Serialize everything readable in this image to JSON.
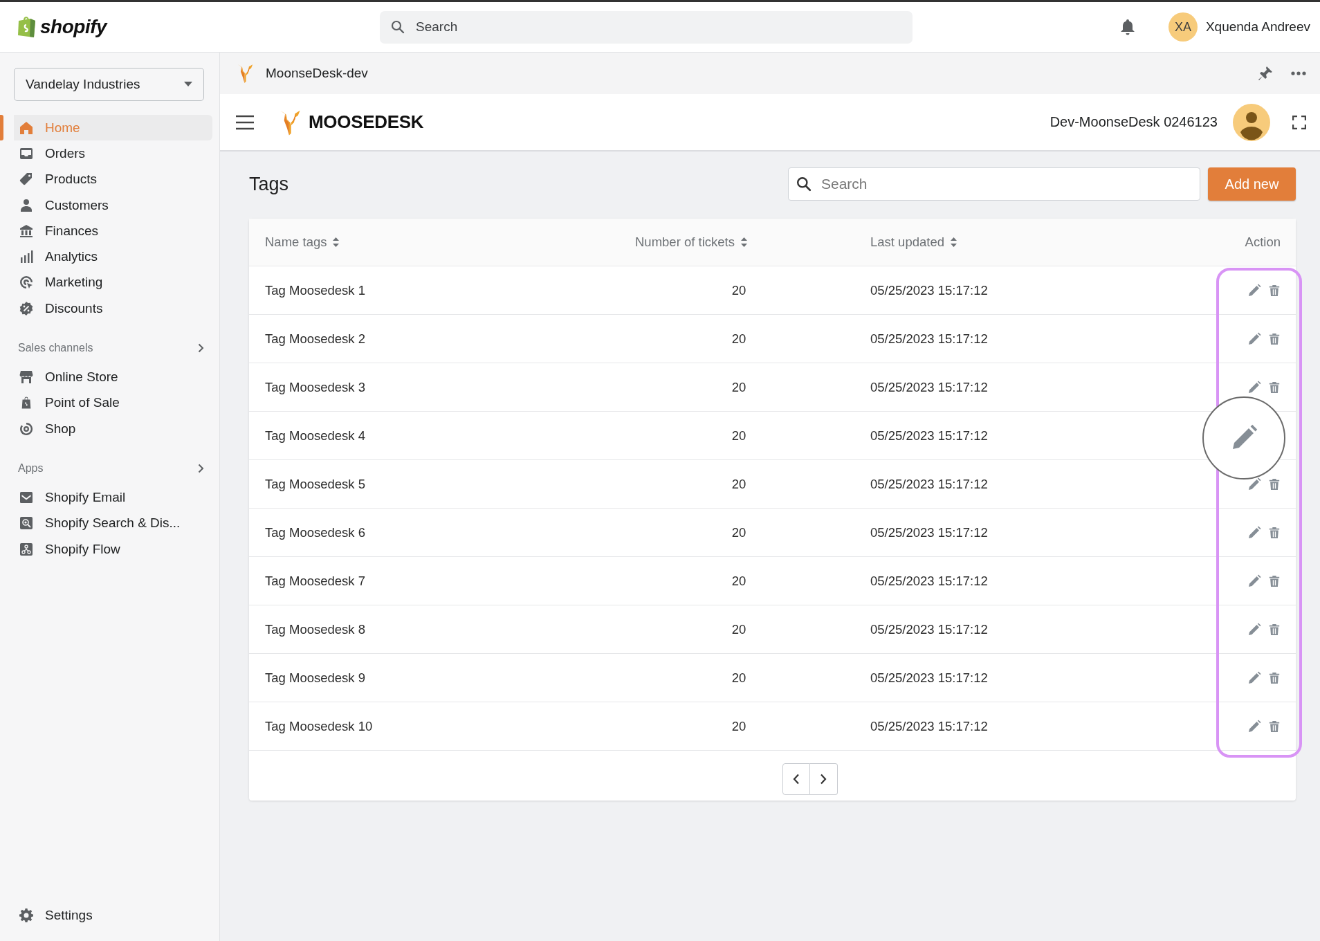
{
  "topbar": {
    "logo_text": "shopify",
    "search": {
      "placeholder": "Search"
    },
    "user": {
      "initials": "XA",
      "name": "Xquenda Andreev"
    }
  },
  "sidebar": {
    "store": "Vandelay Industries",
    "items": [
      {
        "label": "Home",
        "selected": true
      },
      {
        "label": "Orders",
        "selected": false
      },
      {
        "label": "Products",
        "selected": false
      },
      {
        "label": "Customers",
        "selected": false
      },
      {
        "label": "Finances",
        "selected": false
      },
      {
        "label": "Analytics",
        "selected": false
      },
      {
        "label": "Marketing",
        "selected": false
      },
      {
        "label": "Discounts",
        "selected": false
      }
    ],
    "sections": [
      {
        "title": "Sales channels",
        "items": [
          {
            "label": "Online Store",
            "selected": false
          },
          {
            "label": "Point of Sale",
            "selected": false
          },
          {
            "label": "Shop",
            "selected": false
          }
        ]
      },
      {
        "title": "Apps",
        "items": [
          {
            "label": "Shopify Email",
            "selected": false
          },
          {
            "label": "Shopify Search & Dis...",
            "selected": false
          },
          {
            "label": "Shopify Flow",
            "selected": false
          }
        ]
      }
    ],
    "settings": "Settings"
  },
  "app_bar": {
    "title": "MoonseDesk-dev"
  },
  "app_header": {
    "logo_text": "MOOSEDESK",
    "account": "Dev-MoonseDesk 0246123"
  },
  "page": {
    "title": "Tags",
    "search": {
      "placeholder": "Search"
    },
    "add_button": "Add new"
  },
  "table": {
    "columns": [
      {
        "label": "Name tags",
        "sortable": true
      },
      {
        "label": "Number of tickets",
        "sortable": true
      },
      {
        "label": "Last updated",
        "sortable": true
      },
      {
        "label": "Action",
        "sortable": false
      }
    ],
    "rows": [
      {
        "name": "Tag Moosedesk 1",
        "tickets": "20",
        "updated": "05/25/2023 15:17:12",
        "magnified": false
      },
      {
        "name": "Tag Moosedesk 2",
        "tickets": "20",
        "updated": "05/25/2023 15:17:12",
        "magnified": false
      },
      {
        "name": "Tag Moosedesk 3",
        "tickets": "20",
        "updated": "05/25/2023 15:17:12",
        "magnified": false
      },
      {
        "name": "Tag Moosedesk 4",
        "tickets": "20",
        "updated": "05/25/2023 15:17:12",
        "magnified": true
      },
      {
        "name": "Tag Moosedesk 5",
        "tickets": "20",
        "updated": "05/25/2023 15:17:12",
        "magnified": false
      },
      {
        "name": "Tag Moosedesk 6",
        "tickets": "20",
        "updated": "05/25/2023 15:17:12",
        "magnified": false
      },
      {
        "name": "Tag Moosedesk 7",
        "tickets": "20",
        "updated": "05/25/2023 15:17:12",
        "magnified": false
      },
      {
        "name": "Tag Moosedesk 8",
        "tickets": "20",
        "updated": "05/25/2023 15:17:12",
        "magnified": false
      },
      {
        "name": "Tag Moosedesk 9",
        "tickets": "20",
        "updated": "05/25/2023 15:17:12",
        "magnified": false
      },
      {
        "name": "Tag Moosedesk 10",
        "tickets": "20",
        "updated": "05/25/2023 15:17:12",
        "magnified": false
      }
    ]
  }
}
